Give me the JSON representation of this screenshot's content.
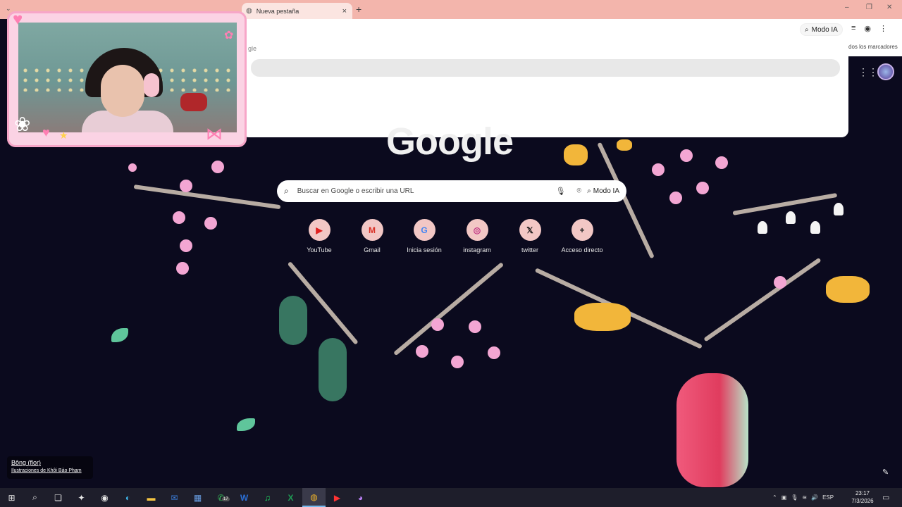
{
  "browser": {
    "tab_title": "Nueva pestaña",
    "tab_close": "×",
    "new_tab": "+",
    "window_controls": {
      "minimize": "–",
      "maximize": "❐",
      "close": "✕"
    },
    "omnibox_panel": {
      "ghost_text": "gle",
      "ai_mode_label": "Modo IA"
    },
    "bookmarks_all": "dos los marcadores"
  },
  "webcam": {},
  "newtab": {
    "logo": "Google",
    "search": {
      "placeholder": "Buscar en Google o escribir una URL",
      "ai_mode_label": "Modo IA"
    },
    "shortcuts": [
      {
        "label": "YouTube",
        "icon": "youtube-icon",
        "glyph": "▶",
        "color": "#e02020"
      },
      {
        "label": "Gmail",
        "icon": "gmail-icon",
        "glyph": "M",
        "color": "#d93025"
      },
      {
        "label": "Inicia sesión",
        "icon": "google-icon",
        "glyph": "G",
        "color": "#4285f4"
      },
      {
        "label": "instagram",
        "icon": "instagram-icon",
        "glyph": "◎",
        "color": "#c13584"
      },
      {
        "label": "twitter",
        "icon": "x-icon",
        "glyph": "𝕏",
        "color": "#111111"
      },
      {
        "label": "Acceso directo",
        "icon": "add-icon",
        "glyph": "+",
        "color": "#222222"
      }
    ],
    "theme_credit": {
      "name": "Bông (flor)",
      "author": "Ilustraciones de Khôi Bảo Phạm"
    }
  },
  "taskbar": {
    "items": [
      {
        "name": "start-icon",
        "glyph": "⊞"
      },
      {
        "name": "search-icon",
        "glyph": "⌕"
      },
      {
        "name": "task-view-icon",
        "glyph": "❏"
      },
      {
        "name": "copilot-icon",
        "glyph": "✦"
      },
      {
        "name": "app-icon",
        "glyph": "◉"
      },
      {
        "name": "edge-icon",
        "glyph": "◐"
      },
      {
        "name": "file-explorer-icon",
        "glyph": "▬"
      },
      {
        "name": "outlook-icon",
        "glyph": "✉"
      },
      {
        "name": "calculator-icon",
        "glyph": "▦"
      },
      {
        "name": "whatsapp-icon",
        "glyph": "✆"
      },
      {
        "name": "word-icon",
        "glyph": "W"
      },
      {
        "name": "spotify-icon",
        "glyph": "♫"
      },
      {
        "name": "excel-icon",
        "glyph": "X"
      },
      {
        "name": "chrome-icon",
        "glyph": "◍"
      },
      {
        "name": "youtube-music-icon",
        "glyph": "▶"
      },
      {
        "name": "discord-icon",
        "glyph": "◕"
      }
    ],
    "whatsapp_badge": "17",
    "tray": {
      "language": "ESP"
    },
    "time": "23:17",
    "date": "7/3/2026"
  },
  "colors": {
    "tabbar": "#f3b5ac",
    "background": "#0b0a1e",
    "cam_frame": "#fbd3e4"
  }
}
